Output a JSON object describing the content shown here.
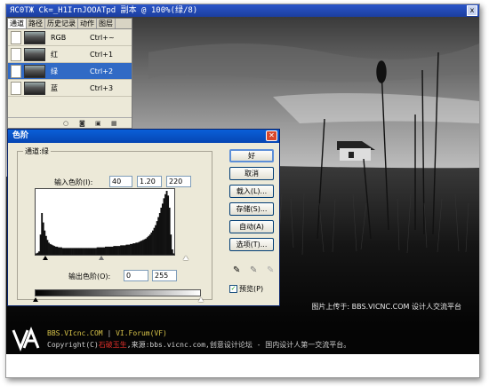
{
  "document": {
    "title": "ЯС0ТЖ Ck=_H1IrnJOOATpd 副本 @ 100%(绿/8)",
    "close_label": "x",
    "photo_credit": "图片上传于: BBS.VICNC.COM 设计人交流平台"
  },
  "channels_panel": {
    "tabs": [
      "通道",
      "路径",
      "历史记录",
      "动作",
      "图层"
    ],
    "active_tab": "通道",
    "rows": [
      {
        "name": "RGB",
        "shortcut": "Ctrl+~",
        "visible": false,
        "selected": false
      },
      {
        "name": "红",
        "shortcut": "Ctrl+1",
        "visible": false,
        "selected": false
      },
      {
        "name": "绿",
        "shortcut": "Ctrl+2",
        "visible": true,
        "selected": true
      },
      {
        "name": "蓝",
        "shortcut": "Ctrl+3",
        "visible": false,
        "selected": false
      }
    ]
  },
  "levels_dialog": {
    "title": "色阶",
    "channel_label": "通道:绿",
    "input_levels_label": "输入色阶(I):",
    "input_black": "40",
    "input_gamma": "1.20",
    "input_white": "220",
    "output_levels_label": "输出色阶(O):",
    "output_black": "0",
    "output_white": "255",
    "buttons": {
      "ok": "好",
      "cancel": "取消",
      "load": "载入(L)...",
      "save": "存储(S)...",
      "auto": "自动(A)",
      "options": "选项(T)..."
    },
    "preview_label": "预览(P)",
    "preview_checked": true,
    "histogram": [
      2,
      3,
      5,
      30,
      62,
      48,
      36,
      28,
      22,
      18,
      16,
      15,
      14,
      13,
      12,
      12,
      11,
      11,
      11,
      10,
      10,
      10,
      10,
      10,
      10,
      10,
      10,
      10,
      10,
      10,
      10,
      10,
      10,
      10,
      10,
      10,
      10,
      10,
      10,
      10,
      10,
      10,
      10,
      10,
      11,
      11,
      11,
      11,
      11,
      11,
      12,
      12,
      12,
      12,
      12,
      12,
      13,
      13,
      13,
      13,
      13,
      14,
      14,
      14,
      14,
      15,
      15,
      15,
      16,
      16,
      17,
      17,
      18,
      18,
      19,
      20,
      21,
      22,
      23,
      24,
      26,
      28,
      30,
      33,
      36,
      40,
      44,
      50,
      56,
      62,
      70,
      76,
      84,
      90,
      95,
      88,
      70,
      30,
      8,
      2
    ]
  },
  "footer": {
    "logo": "VA",
    "line1_left": "BBS.VIcnc.COM",
    "line1_sep": " | ",
    "line1_right": "VI.Forum(VF)",
    "line2_prefix": "Copyright(C)",
    "line2_author": "石破玉生",
    "line2_rest": ",来源:bbs.vicnc.com,创意设计论坛 - 国内设计人第一交流平台。"
  }
}
